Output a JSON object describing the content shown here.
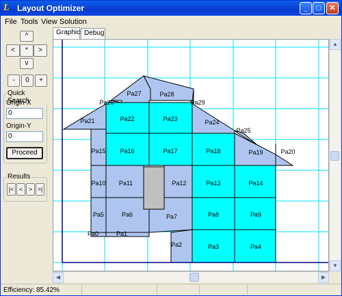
{
  "window": {
    "title": "Layout Optimizer",
    "minimize": "_",
    "maximize": "□",
    "close": "✕"
  },
  "menu": [
    "File",
    "Tools",
    "View",
    "Solution"
  ],
  "nav": {
    "up": "^",
    "left": "<",
    "center": "*",
    "right": ">",
    "down": "v",
    "minus": "-",
    "zoom": "0",
    "plus": "+"
  },
  "quick_search": {
    "title": "Quick Search",
    "origin_x_label": "Origin-X",
    "origin_x_value": "0",
    "origin_y_label": "Origin-Y",
    "origin_y_value": "0",
    "proceed": "Proceed"
  },
  "results": {
    "title": "Results",
    "first": "|<",
    "prev": "<",
    "next": ">",
    "last": ">|"
  },
  "tabs": [
    {
      "label": "Graphics",
      "active": true
    },
    {
      "label": "Debug",
      "active": false
    }
  ],
  "status": {
    "label": "Efficiency:",
    "value": "85.42%"
  },
  "colors": {
    "blue_panel": "#aec6ef",
    "cyan_panel": "#00ffff",
    "grid": "#00e0ff",
    "obstacle": "#c0c0c0"
  },
  "panels": [
    {
      "id": "Pa27",
      "color": "blue"
    },
    {
      "id": "Pa28",
      "color": "blue"
    },
    {
      "id": "Pa26",
      "color": "blue"
    },
    {
      "id": "Pa29",
      "color": "blue"
    },
    {
      "id": "Pa21",
      "color": "blue"
    },
    {
      "id": "Pa22",
      "color": "cyan"
    },
    {
      "id": "Pa23",
      "color": "cyan"
    },
    {
      "id": "Pa24",
      "color": "blue"
    },
    {
      "id": "Pa25",
      "color": "blue"
    },
    {
      "id": "Pa20",
      "color": "blue"
    },
    {
      "id": "Pa15",
      "color": "blue"
    },
    {
      "id": "Pa16",
      "color": "cyan"
    },
    {
      "id": "Pa17",
      "color": "cyan"
    },
    {
      "id": "Pa18",
      "color": "cyan"
    },
    {
      "id": "Pa19",
      "color": "blue"
    },
    {
      "id": "Pa10",
      "color": "blue"
    },
    {
      "id": "Pa11",
      "color": "blue"
    },
    {
      "id": "Pa12",
      "color": "blue"
    },
    {
      "id": "Pa13",
      "color": "cyan"
    },
    {
      "id": "Pa14",
      "color": "cyan"
    },
    {
      "id": "Pa5",
      "color": "blue"
    },
    {
      "id": "Pa6",
      "color": "blue"
    },
    {
      "id": "Pa7",
      "color": "blue"
    },
    {
      "id": "Pa8",
      "color": "cyan"
    },
    {
      "id": "Pa9",
      "color": "cyan"
    },
    {
      "id": "Pa0",
      "color": "blue"
    },
    {
      "id": "Pa1",
      "color": "blue"
    },
    {
      "id": "Pa2",
      "color": "blue"
    },
    {
      "id": "Pa3",
      "color": "cyan"
    },
    {
      "id": "Pa4",
      "color": "cyan"
    }
  ]
}
